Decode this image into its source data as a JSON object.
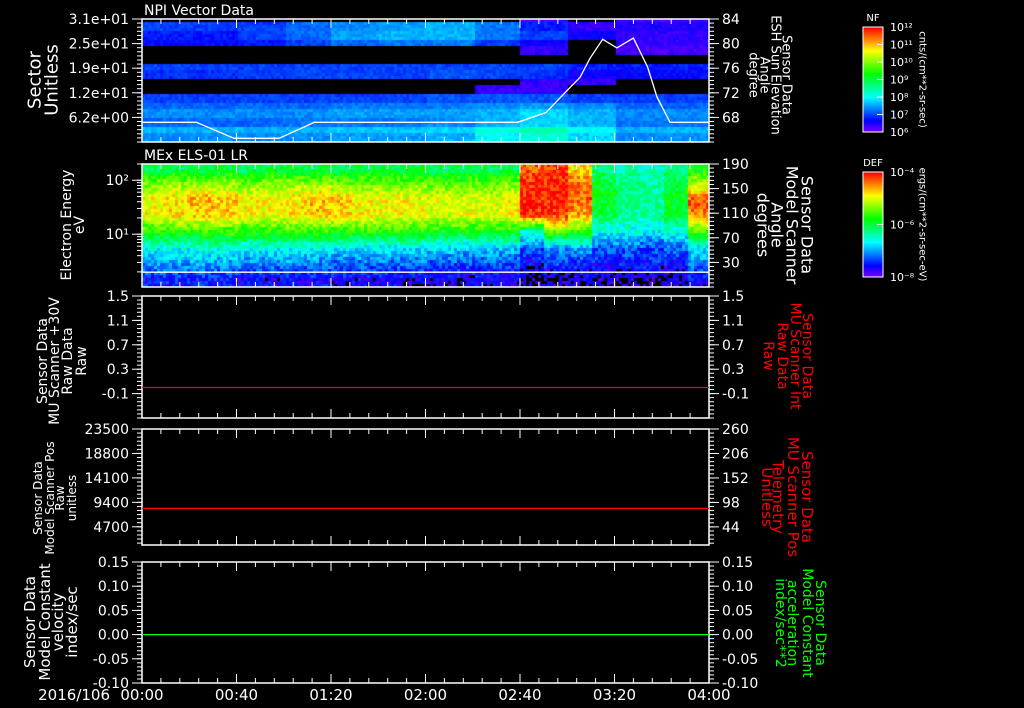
{
  "date_label": "2016/106",
  "time_axis": {
    "range": [
      "00:00",
      "04:00"
    ],
    "tick_labels": [
      "00:00",
      "00:40",
      "01:20",
      "02:00",
      "02:40",
      "03:20",
      "04:00"
    ],
    "minor_tick_interval_min": 8
  },
  "colors": {
    "background": "#000000",
    "axes": "#ffffff",
    "panel3_line": "#d01818",
    "panel4_line": "#ff0000",
    "panel5_line": "#00ff00",
    "colormap": "rainbow (purple low to red high)"
  },
  "chart_data": [
    {
      "type": "heatmap",
      "title": "NPI Vector Data",
      "y_label_lines": [
        "Sector",
        "Unitless"
      ],
      "ylim": [
        0,
        31
      ],
      "y_ticks": [
        6.2,
        12.4,
        18.6,
        24.8,
        31
      ],
      "y_tick_labels": [
        "6.2e+00",
        "1.2e+01",
        "1.9e+01",
        "2.5e+01",
        "3.1e+01"
      ],
      "y_bin_size": 2,
      "time_bin_min": 20,
      "z_note_log10": true,
      "z_rows_bottom_to_top": [
        [
          7.4,
          7.4,
          7.4,
          7.4,
          7.5,
          7.5,
          7.6,
          8.0,
          8.2,
          7.8,
          7.4,
          7.4
        ],
        [
          7.6,
          7.6,
          7.6,
          7.6,
          7.7,
          7.7,
          7.8,
          8.2,
          8.4,
          8.0,
          7.6,
          7.6
        ],
        [
          7.2,
          7.2,
          7.2,
          7.3,
          7.3,
          7.3,
          7.4,
          7.6,
          7.8,
          7.6,
          7.3,
          7.3
        ],
        [
          7.4,
          7.4,
          7.4,
          7.4,
          7.5,
          7.5,
          7.5,
          7.6,
          7.8,
          7.6,
          7.4,
          7.4
        ],
        [
          7.2,
          7.2,
          7.2,
          7.2,
          7.3,
          7.3,
          7.3,
          7.4,
          7.5,
          7.4,
          7.2,
          7.2
        ],
        [
          7.0,
          7.0,
          7.0,
          7.0,
          7.0,
          7.0,
          7.1,
          7.1,
          7.1,
          7.0,
          7.0,
          7.0
        ],
        [
          0,
          0,
          0,
          0,
          0,
          0,
          0,
          6.4,
          6.4,
          0,
          0,
          0
        ],
        [
          0,
          0,
          0,
          0,
          0,
          0,
          0,
          0,
          6.4,
          6.4,
          0,
          0
        ],
        [
          6.9,
          6.9,
          7.0,
          7.0,
          7.0,
          7.0,
          7.1,
          7.0,
          6.9,
          6.6,
          6.7,
          6.7
        ],
        [
          7.0,
          7.0,
          7.0,
          7.0,
          7.0,
          7.0,
          7.0,
          7.0,
          7.0,
          6.8,
          6.8,
          6.8
        ],
        [
          0,
          0,
          0,
          0,
          0,
          0,
          0,
          0,
          0,
          0,
          0,
          0
        ],
        [
          0,
          0,
          0,
          0,
          0,
          0,
          0,
          0,
          6.4,
          0,
          6.3,
          6.3
        ],
        [
          6.7,
          6.7,
          6.8,
          7.0,
          7.2,
          7.3,
          7.3,
          7.0,
          6.6,
          0,
          6.4,
          6.4
        ],
        [
          6.8,
          6.8,
          7.0,
          7.2,
          7.5,
          7.6,
          7.6,
          7.3,
          7.0,
          6.6,
          6.4,
          6.4
        ],
        [
          7.0,
          7.0,
          7.0,
          7.2,
          7.4,
          7.5,
          7.6,
          7.3,
          6.8,
          6.4,
          6.5,
          6.5
        ],
        [
          0,
          0,
          0,
          0,
          0,
          0,
          0,
          0,
          6.3,
          0,
          6.3,
          6.3
        ]
      ],
      "colorbar": {
        "label": "NF",
        "unit": "cnts/(cm**2-sr-sec)",
        "log_range": [
          6,
          12
        ],
        "tick_labels": [
          "10¹²",
          "10¹¹",
          "10¹⁰",
          "10⁹",
          "10⁸",
          "10⁷",
          "10⁶"
        ]
      },
      "overlay": {
        "type": "line",
        "color": "#ffffff",
        "y2_label_lines": [
          "Sensor Data",
          "ESH Sun Elevation",
          "Angle",
          "degree"
        ],
        "y2lim": [
          64,
          84
        ],
        "y2_ticks": [
          68,
          72,
          76,
          80,
          84
        ],
        "y2_tick_labels": [
          "68",
          "72",
          "76",
          "80",
          "84"
        ],
        "t_min": [
          0,
          23,
          39,
          58,
          73,
          159,
          171,
          180,
          185.4,
          189.6,
          195,
          201,
          208,
          214,
          218,
          223.5,
          240
        ],
        "values": [
          67.2,
          67.2,
          64.6,
          64.6,
          67.2,
          67.2,
          68.8,
          72.4,
          74.5,
          77.6,
          80.7,
          79.3,
          80.9,
          76.2,
          71.3,
          67.2,
          67.2
        ]
      }
    },
    {
      "type": "heatmap",
      "title": "MEx ELS-01 LR",
      "y_label_lines": [
        "Electron Energy",
        "eV"
      ],
      "ylim": [
        1.05,
        200
      ],
      "y_log": true,
      "y_ticks": [
        10,
        100
      ],
      "y_tick_labels": [
        "10¹",
        "10²"
      ],
      "log10_energy_bin_centers": [
        0.15,
        0.45,
        0.75,
        1.05,
        1.35,
        1.65,
        1.95,
        2.2
      ],
      "time_bin_min": 10,
      "z_rows_bottom_to_top": [
        [
          -7.5,
          -7.5,
          -7.5,
          -7.5,
          -7.6,
          -7.6,
          -7.6,
          -7.6,
          -7.6,
          -7.6,
          -7.6,
          -7.7,
          -7.7,
          -7.7,
          -7.7,
          -7.7,
          -7.9,
          -7.8,
          -7.8,
          -7.8,
          -7.8,
          -7.8,
          -7.8,
          -7.6
        ],
        [
          -7.0,
          -7.0,
          -7.0,
          -7.0,
          -7.1,
          -7.1,
          -7.1,
          -7.1,
          -7.2,
          -7.2,
          -7.2,
          -7.2,
          -7.3,
          -7.3,
          -7.3,
          -7.3,
          -7.6,
          -7.4,
          -7.4,
          -7.5,
          -7.5,
          -7.5,
          -7.5,
          -7.1
        ],
        [
          -6.6,
          -6.6,
          -6.5,
          -6.5,
          -6.6,
          -6.6,
          -6.6,
          -6.6,
          -6.7,
          -6.7,
          -6.7,
          -6.7,
          -6.8,
          -6.8,
          -6.8,
          -6.8,
          -7.2,
          -7.0,
          -6.9,
          -7.2,
          -7.2,
          -7.3,
          -7.2,
          -6.7
        ],
        [
          -5.7,
          -5.7,
          -5.6,
          -5.6,
          -5.7,
          -5.7,
          -5.6,
          -5.6,
          -5.7,
          -5.7,
          -5.7,
          -5.7,
          -5.8,
          -5.8,
          -5.8,
          -5.8,
          -6.4,
          -5.4,
          -5.6,
          -6.6,
          -6.6,
          -6.7,
          -6.5,
          -5.6
        ],
        [
          -4.9,
          -4.8,
          -4.7,
          -4.7,
          -4.9,
          -4.9,
          -4.8,
          -4.7,
          -4.8,
          -4.9,
          -4.9,
          -4.9,
          -5.0,
          -5.0,
          -5.0,
          -4.9,
          -4.2,
          -4.2,
          -4.6,
          -6.0,
          -6.3,
          -6.3,
          -6.0,
          -4.4
        ],
        [
          -4.9,
          -4.8,
          -4.6,
          -4.7,
          -4.9,
          -4.9,
          -4.8,
          -4.6,
          -4.7,
          -4.9,
          -4.9,
          -4.9,
          -5.0,
          -5.0,
          -5.0,
          -4.9,
          -4.1,
          -4.1,
          -4.3,
          -5.9,
          -6.2,
          -6.3,
          -5.8,
          -4.3
        ],
        [
          -5.4,
          -5.3,
          -5.3,
          -5.3,
          -5.4,
          -5.3,
          -5.3,
          -5.3,
          -5.4,
          -5.4,
          -5.4,
          -5.4,
          -5.5,
          -5.5,
          -5.5,
          -5.4,
          -4.1,
          -4.1,
          -4.4,
          -6.0,
          -6.2,
          -6.3,
          -6.0,
          -5.2
        ],
        [
          -6.1,
          -6.0,
          -6.0,
          -6.0,
          -6.1,
          -6.0,
          -6.0,
          -6.0,
          -6.1,
          -6.0,
          -6.0,
          -6.0,
          -6.1,
          -6.1,
          -6.1,
          -6.1,
          -4.3,
          -4.2,
          -4.8,
          -6.2,
          -6.4,
          -6.5,
          -6.3,
          -5.8
        ]
      ],
      "colorbar": {
        "label": "DEF",
        "unit": "ergs/(cm**2-sr-sec-eV)",
        "log_range": [
          -8,
          -4
        ],
        "tick_labels": [
          "10⁻⁴",
          "10⁻⁶",
          "10⁻⁸"
        ]
      },
      "overlay": {
        "type": "line",
        "color": "#ffffff",
        "y2_label_lines": [
          "Sensor Data",
          "Model Scanner",
          "Angle",
          "degrees"
        ],
        "y2lim": [
          -10,
          190
        ],
        "y2_ticks": [
          30,
          70,
          110,
          150,
          190
        ],
        "y2_tick_labels": [
          "30",
          "70",
          "110",
          "150",
          "190"
        ],
        "t_min": [
          0,
          240
        ],
        "values": [
          14,
          14
        ]
      }
    },
    {
      "type": "line",
      "y_label_lines": [
        "Sensor Data",
        "MU Scanner +30V",
        "Raw Data",
        "Raw"
      ],
      "ylim": [
        -0.5,
        1.5
      ],
      "y_ticks": [
        -0.1,
        0.3,
        0.7,
        1.1,
        1.5
      ],
      "y_tick_labels": [
        "-0.1",
        "0.3",
        "0.7",
        "1.1",
        "1.5"
      ],
      "y2_label_lines": [
        "Sensor Data",
        "MU Scanner Int",
        "Raw Data",
        "Raw"
      ],
      "y2_label_color": "#ff0000",
      "y2lim": [
        -0.5,
        1.5
      ],
      "y2_ticks": [
        -0.1,
        0.3,
        0.7,
        1.1,
        1.5
      ],
      "y2_tick_labels": [
        "-0.1",
        "0.3",
        "0.7",
        "1.1",
        "1.5"
      ],
      "series": [
        {
          "color": "#d01818",
          "axis": "right",
          "t_min": [
            0,
            240
          ],
          "values": [
            0,
            0
          ]
        }
      ]
    },
    {
      "type": "line",
      "y_label_lines": [
        "Sensor Data",
        "Model Scanner Pos",
        "Raw",
        "unitless"
      ],
      "ylim": [
        1200,
        23500
      ],
      "y_ticks": [
        4700,
        9400,
        14100,
        18800,
        23500
      ],
      "y_tick_labels": [
        "4700",
        "9400",
        "14100",
        "18800",
        "23500"
      ],
      "y2_label_lines": [
        "Sensor Data",
        "MU Scanner Pos",
        "Telemetry",
        "Unitless"
      ],
      "y2_label_color": "#ff0000",
      "y2lim": [
        4,
        260
      ],
      "y2_ticks": [
        44,
        98,
        152,
        206,
        260
      ],
      "y2_tick_labels": [
        "44",
        "98",
        "152",
        "206",
        "260"
      ],
      "series": [
        {
          "color": "#ff0000",
          "axis": "left",
          "t_min": [
            0,
            240
          ],
          "values": [
            8240,
            8240
          ]
        }
      ]
    },
    {
      "type": "line",
      "y_label_lines": [
        "Sensor Data",
        "Model Constant",
        "velocity",
        "index/sec"
      ],
      "ylim": [
        -0.1,
        0.15
      ],
      "y_ticks": [
        -0.1,
        -0.05,
        0.0,
        0.05,
        0.1,
        0.15
      ],
      "y_tick_labels": [
        "-0.10",
        "-0.05",
        "0.00",
        "0.05",
        "0.10",
        "0.15"
      ],
      "y2_label_lines": [
        "Sensor Data",
        "Model Constant",
        "acceleration",
        "index/sec**2"
      ],
      "y2_label_color": "#00ff00",
      "y2lim": [
        -0.1,
        0.15
      ],
      "y2_ticks": [
        -0.1,
        -0.05,
        0.0,
        0.05,
        0.1,
        0.15
      ],
      "y2_tick_labels": [
        "-0.10",
        "-0.05",
        "0.00",
        "0.05",
        "0.10",
        "0.15"
      ],
      "series": [
        {
          "color": "#00ff00",
          "axis": "left",
          "t_min": [
            0,
            240
          ],
          "values": [
            0,
            0
          ]
        }
      ]
    }
  ]
}
